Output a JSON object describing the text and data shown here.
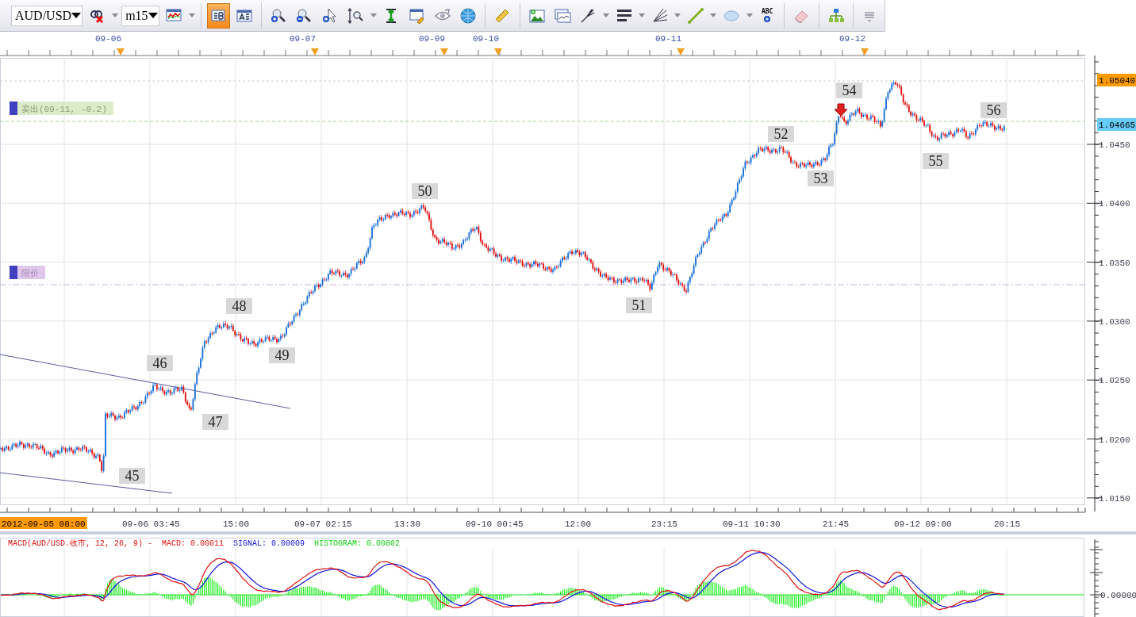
{
  "toolbar": {
    "symbol": {
      "value": "AUD/USD"
    },
    "timeframe": {
      "value": "m15"
    },
    "buttons": [
      {
        "selected": false,
        "menu": true
      },
      {
        "selected": false,
        "menu": true
      },
      {
        "selected": true,
        "menu": false
      },
      {
        "selected": false,
        "menu": false
      },
      {
        "selected": false,
        "menu": false
      },
      {
        "selected": false,
        "menu": false
      },
      {
        "selected": false,
        "menu": false
      },
      {
        "selected": false,
        "menu": true
      },
      {
        "selected": false,
        "menu": false
      },
      {
        "selected": false,
        "menu": false
      },
      {
        "selected": false,
        "menu": false
      },
      {
        "selected": false,
        "menu": false
      },
      {
        "selected": false,
        "menu": false
      },
      {
        "selected": false,
        "menu": false
      },
      {
        "selected": false,
        "menu": false
      },
      {
        "selected": false,
        "menu": true
      },
      {
        "selected": false,
        "menu": true
      },
      {
        "selected": false,
        "menu": true
      },
      {
        "selected": false,
        "menu": true
      },
      {
        "selected": false,
        "menu": true
      },
      {
        "selected": false,
        "menu": false,
        "label": "ABC"
      },
      {
        "selected": false,
        "menu": false
      },
      {
        "selected": false,
        "menu": false
      },
      {
        "selected": false,
        "menu": false
      }
    ]
  },
  "top_dates": [
    "09-06",
    "09-07",
    "09-09",
    "09-10",
    "09-11",
    "09-12"
  ],
  "orders": [
    {
      "kind": "sell",
      "label": "卖出(09-11, -0.2)"
    },
    {
      "kind": "limit",
      "label": "限价"
    }
  ],
  "wave_labels": [
    "45",
    "46",
    "47",
    "48",
    "49",
    "50",
    "51",
    "52",
    "53",
    "54",
    "55",
    "56"
  ],
  "price_axis": {
    "ticks": [
      "1.0450",
      "1.0400",
      "1.0350",
      "1.0300",
      "1.0250",
      "1.0200",
      "1.0150"
    ],
    "markers": [
      {
        "kind": "high",
        "label": "1.05040"
      },
      {
        "kind": "current",
        "label": "1.04665"
      }
    ]
  },
  "time_axis": [
    {
      "label": "2012-09-05 08:00",
      "selected": true
    },
    {
      "label": "09-06 03:45",
      "selected": false
    },
    {
      "label": "15:00",
      "selected": false
    },
    {
      "label": "09-07 02:15",
      "selected": false
    },
    {
      "label": "13:30",
      "selected": false
    },
    {
      "label": "09-10 00:45",
      "selected": false
    },
    {
      "label": "12:00",
      "selected": false
    },
    {
      "label": "23:15",
      "selected": false
    },
    {
      "label": "09-11 10:30",
      "selected": false
    },
    {
      "label": "21:45",
      "selected": false
    },
    {
      "label": "09-12 09:00",
      "selected": false
    },
    {
      "label": "20:15",
      "selected": false
    }
  ],
  "macd": {
    "title": "MACD(AUD/USD.收市, 12, 26, 9) -",
    "macd": "MACD: 0.00011",
    "signal": "SIGNAL: 0.00009",
    "histogram": "HISTOGRAM: 0.00002",
    "axis_label": "0.00000"
  }
}
